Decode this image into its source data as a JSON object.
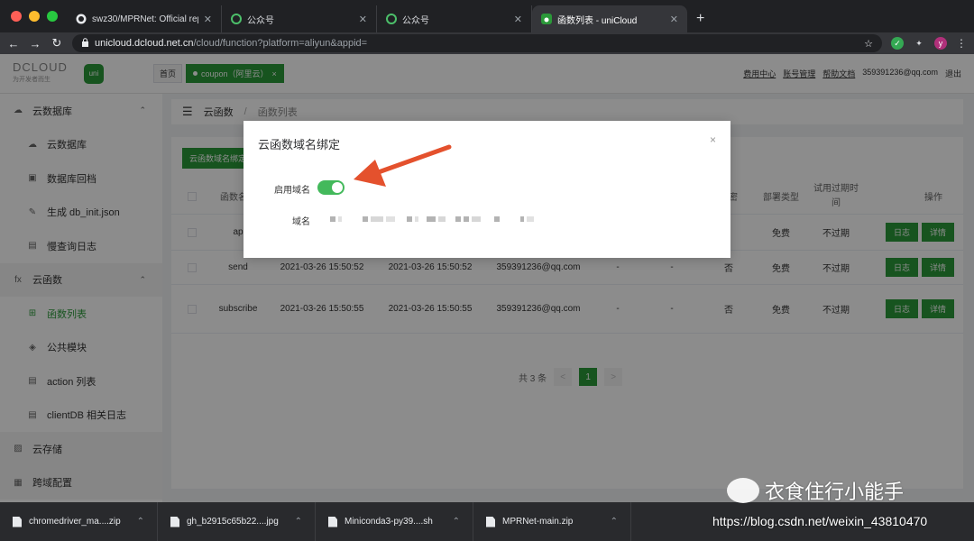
{
  "browser": {
    "tabs": [
      {
        "label": "swz30/MPRNet: Official reposi",
        "active": false,
        "icon": "github-icon"
      },
      {
        "label": "公众号",
        "active": false,
        "icon": "wechat-icon"
      },
      {
        "label": "公众号",
        "active": false,
        "icon": "wechat-icon"
      },
      {
        "label": "函数列表 - uniCloud",
        "active": true,
        "icon": "unicloud-icon"
      }
    ],
    "url_host": "unicloud.dcloud.net.cn",
    "url_path": "/cloud/function?platform=aliyun&appid=",
    "profile_initial": "y"
  },
  "header": {
    "logo_text": "DCLOUD",
    "logo_slogan": "为开发者而生",
    "uni_badge": "uni",
    "home_tab": "首页",
    "space_tab": "coupon（阿里云）",
    "space_tab_close": "×",
    "links": [
      "费用中心",
      "账号管理",
      "帮助文档"
    ],
    "email": "359391236@qq.com",
    "logout": "退出"
  },
  "sidebar": {
    "items": [
      {
        "label": "云数据库",
        "level": "group",
        "icon": "database-icon",
        "arrow": "⌃"
      },
      {
        "label": "云数据库",
        "level": "sub",
        "icon": "database-icon"
      },
      {
        "label": "数据库回档",
        "level": "sub",
        "icon": "image-icon"
      },
      {
        "label": "生成 db_init.json",
        "level": "sub",
        "icon": "pin-icon"
      },
      {
        "label": "慢查询日志",
        "level": "sub",
        "icon": "document-icon"
      },
      {
        "label": "云函数",
        "level": "group",
        "icon": "fx-icon",
        "arrow": "⌃"
      },
      {
        "label": "函数列表",
        "level": "sub",
        "icon": "grid-icon",
        "active": true
      },
      {
        "label": "公共模块",
        "level": "sub",
        "icon": "cube-icon"
      },
      {
        "label": "action 列表",
        "level": "sub",
        "icon": "list-icon"
      },
      {
        "label": "clientDB 相关日志",
        "level": "sub",
        "icon": "document-icon"
      },
      {
        "label": "云存储",
        "level": "group",
        "icon": "storage-icon"
      },
      {
        "label": "跨域配置",
        "level": "group",
        "icon": "cross-icon"
      }
    ]
  },
  "breadcrumb": {
    "root": "云函数",
    "sep": "/",
    "current": "函数列表"
  },
  "panel": {
    "bind_button": "云函数域名绑定"
  },
  "table": {
    "headers": [
      "函数名",
      "加密",
      "部署类型",
      "试用过期时间",
      "操作"
    ],
    "rows": [
      {
        "name": "ap",
        "created": "",
        "updated": "",
        "creator": "",
        "c1": "",
        "c2": "",
        "encrypt": "",
        "deploy": "免费",
        "trial": "不过期"
      },
      {
        "name": "send",
        "created": "2021-03-26 15:50:52",
        "updated": "2021-03-26 15:50:52",
        "creator": "359391236@qq.com",
        "c1": "-",
        "c2": "-",
        "encrypt": "否",
        "deploy": "免费",
        "trial": "不过期"
      },
      {
        "name": "subscribe",
        "created": "2021-03-26 15:50:55",
        "updated": "2021-03-26 15:50:55",
        "creator": "359391236@qq.com",
        "c1": "-",
        "c2": "-",
        "encrypt": "否",
        "deploy": "免费",
        "trial": "不过期"
      }
    ],
    "log_btn": "日志",
    "detail_btn": "详情"
  },
  "pagination": {
    "total": "共 3 条",
    "prev": "<",
    "page": "1",
    "next": ">"
  },
  "dialog": {
    "title": "云函数域名绑定",
    "close": "×",
    "enable_label": "启用域名",
    "enabled": true,
    "domain_label": "域名"
  },
  "downloads": [
    {
      "name": "chromedriver_ma....zip"
    },
    {
      "name": "gh_b2915c65b22....jpg"
    },
    {
      "name": "Miniconda3-py39....sh"
    },
    {
      "name": "MPRNet-main.zip"
    }
  ],
  "watermark": {
    "account": "衣食住行小能手",
    "url": "https://blog.csdn.net/weixin_43810470"
  },
  "colors": {
    "accent": "#2b9939",
    "arrow": "#e4512d",
    "switch": "#43b95b"
  }
}
